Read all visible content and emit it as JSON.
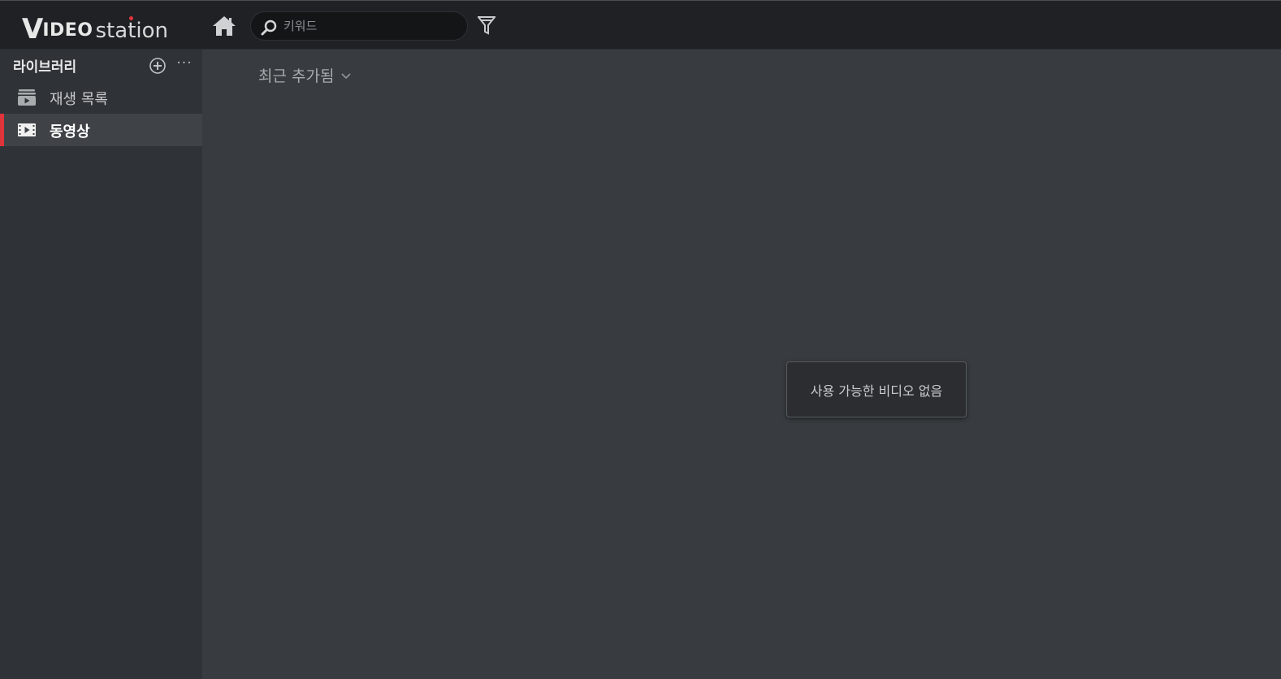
{
  "app": {
    "logo_v": "V",
    "logo_ideo": "IDEO",
    "logo_station": "station"
  },
  "topbar": {
    "home_icon": "home-icon",
    "search": {
      "placeholder": "키워드",
      "value": ""
    },
    "filter_icon": "filter-icon"
  },
  "sidebar": {
    "library_title": "라이브러리",
    "add_icon": "plus-circle-icon",
    "more_label": "···",
    "items": [
      {
        "label": "재생 목록",
        "icon": "playlist-icon",
        "active": false
      },
      {
        "label": "동영상",
        "icon": "film-icon",
        "active": true
      }
    ]
  },
  "main": {
    "sort_label": "최근 추가됨",
    "empty_message": "사용 가능한 비디오 없음"
  },
  "colors": {
    "accent": "#e0343c",
    "topbar_bg": "#1f2124",
    "sidebar_bg": "#2f3236",
    "main_bg": "#383c40"
  }
}
